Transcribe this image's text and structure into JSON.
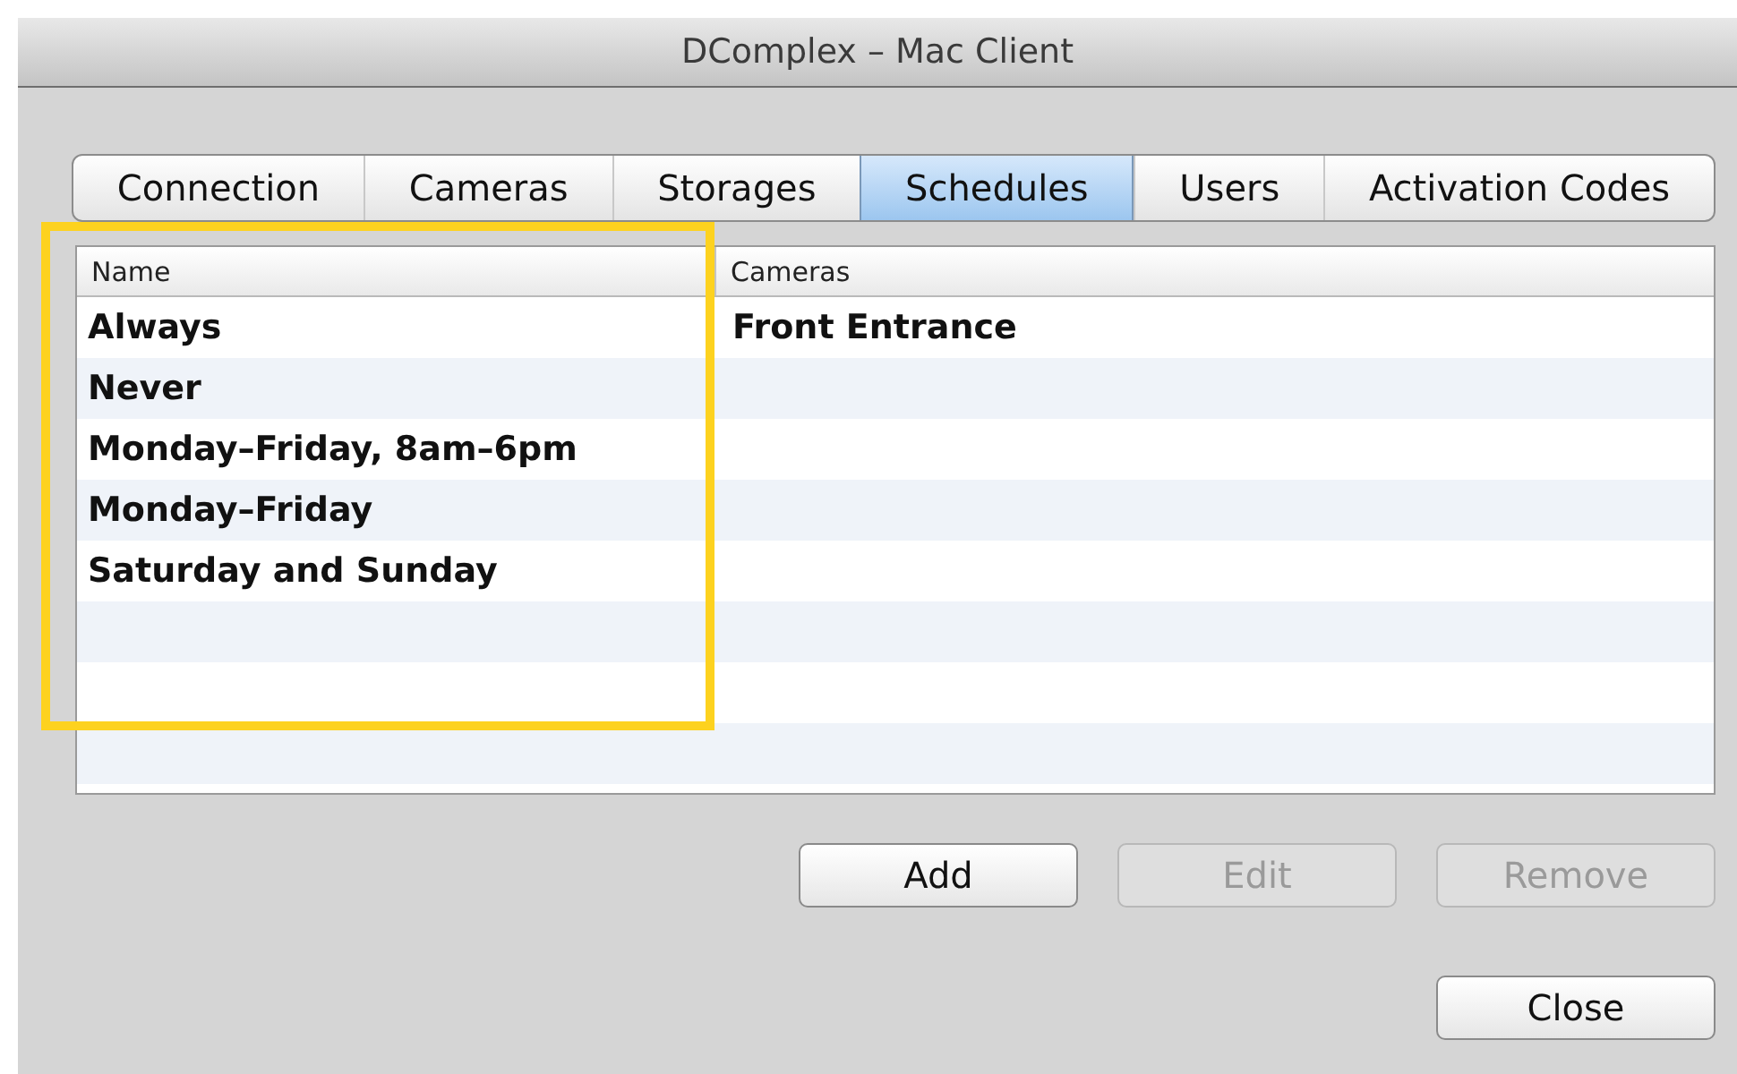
{
  "window": {
    "title": "DComplex – Mac Client"
  },
  "tabs": [
    {
      "label": "Connection",
      "selected": false
    },
    {
      "label": "Cameras",
      "selected": false
    },
    {
      "label": "Storages",
      "selected": false
    },
    {
      "label": "Schedules",
      "selected": true
    },
    {
      "label": "Users",
      "selected": false
    },
    {
      "label": "Activation Codes",
      "selected": false
    }
  ],
  "table": {
    "columns": [
      {
        "label": "Name",
        "highlighted": true
      },
      {
        "label": "Cameras",
        "highlighted": false
      }
    ],
    "rows": [
      {
        "name": "Always",
        "cameras": "Front Entrance"
      },
      {
        "name": "Never"
      },
      {
        "name": "Monday–Friday, 8am–6pm"
      },
      {
        "name": "Monday–Friday"
      },
      {
        "name": "Saturday and Sunday"
      }
    ]
  },
  "buttons": [
    {
      "label": "Add",
      "disabled": false
    },
    {
      "label": "Edit",
      "disabled": true
    },
    {
      "label": "Remove",
      "disabled": true
    }
  ],
  "close_button": {
    "label": "Close",
    "disabled": false
  }
}
